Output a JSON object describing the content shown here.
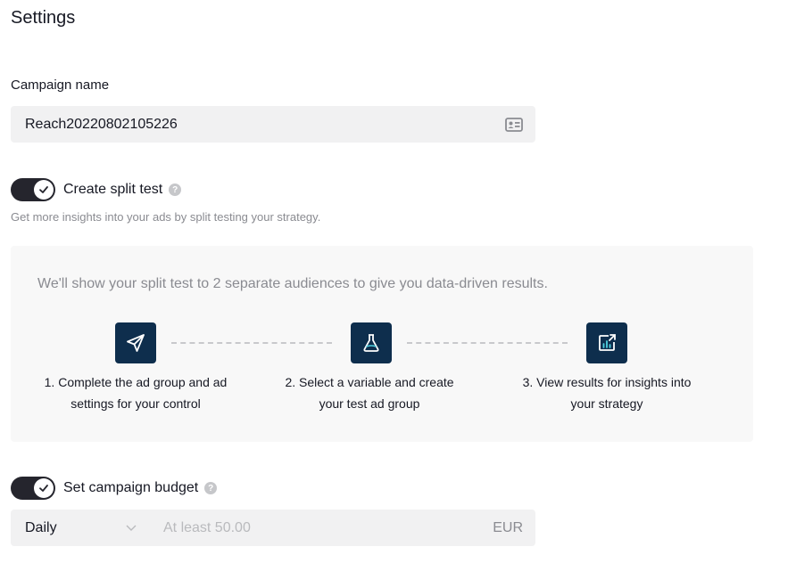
{
  "page": {
    "title": "Settings"
  },
  "campaign_name": {
    "label": "Campaign name",
    "value": "Reach20220802105226",
    "icon": "id-card-icon"
  },
  "split_test": {
    "toggle_on": true,
    "label": "Create split test",
    "description": "Get more insights into your ads by split testing your strategy.",
    "intro": "We'll show your split test to 2 separate audiences to give you data-driven results.",
    "steps": [
      {
        "icon": "send-icon",
        "line1": "1. Complete the ad group and ad",
        "line2": "settings for your control"
      },
      {
        "icon": "flask-icon",
        "line1": "2. Select a variable and create",
        "line2": "your test ad group"
      },
      {
        "icon": "chart-share-icon",
        "line1": "3. View results for insights into",
        "line2": "your strategy"
      }
    ]
  },
  "budget": {
    "toggle_on": true,
    "label": "Set campaign budget",
    "period": "Daily",
    "placeholder": "At least 50.00",
    "currency": "EUR"
  },
  "colors": {
    "accent_dark": "#0e2e4d",
    "toggle": "#25252d",
    "input_bg": "#f1f1f2",
    "panel_bg": "#f8f8f8"
  }
}
